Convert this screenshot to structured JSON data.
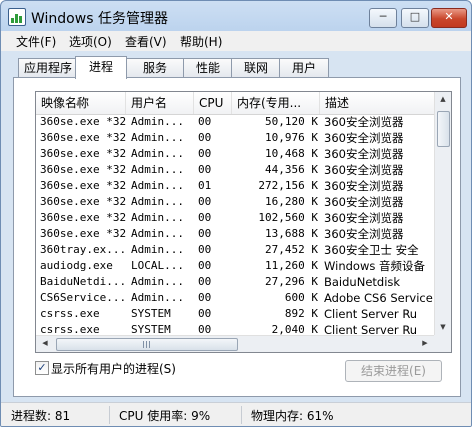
{
  "window": {
    "title": "Windows 任务管理器"
  },
  "menu": [
    "文件(F)",
    "选项(O)",
    "查看(V)",
    "帮助(H)"
  ],
  "tabs": [
    "应用程序",
    "进程",
    "服务",
    "性能",
    "联网",
    "用户"
  ],
  "active_tab": "进程",
  "columns": [
    "映像名称",
    "用户名",
    "CPU",
    "内存(专用...",
    "描述"
  ],
  "rows": [
    {
      "name": "360se.exe *32",
      "user": "Admin...",
      "cpu": "00",
      "mem": "50,120 K",
      "desc": "360安全浏览器"
    },
    {
      "name": "360se.exe *32",
      "user": "Admin...",
      "cpu": "00",
      "mem": "10,976 K",
      "desc": "360安全浏览器"
    },
    {
      "name": "360se.exe *32",
      "user": "Admin...",
      "cpu": "00",
      "mem": "10,468 K",
      "desc": "360安全浏览器"
    },
    {
      "name": "360se.exe *32",
      "user": "Admin...",
      "cpu": "00",
      "mem": "44,356 K",
      "desc": "360安全浏览器"
    },
    {
      "name": "360se.exe *32",
      "user": "Admin...",
      "cpu": "01",
      "mem": "272,156 K",
      "desc": "360安全浏览器"
    },
    {
      "name": "360se.exe *32",
      "user": "Admin...",
      "cpu": "00",
      "mem": "16,280 K",
      "desc": "360安全浏览器"
    },
    {
      "name": "360se.exe *32",
      "user": "Admin...",
      "cpu": "00",
      "mem": "102,560 K",
      "desc": "360安全浏览器"
    },
    {
      "name": "360se.exe *32",
      "user": "Admin...",
      "cpu": "00",
      "mem": "13,688 K",
      "desc": "360安全浏览器"
    },
    {
      "name": "360tray.ex...",
      "user": "Admin...",
      "cpu": "00",
      "mem": "27,452 K",
      "desc": "360安全卫士 安全"
    },
    {
      "name": "audiodg.exe",
      "user": "LOCAL...",
      "cpu": "00",
      "mem": "11,260 K",
      "desc": "Windows 音频设备"
    },
    {
      "name": "BaiduNetdi...",
      "user": "Admin...",
      "cpu": "00",
      "mem": "27,296 K",
      "desc": "BaiduNetdisk"
    },
    {
      "name": "CS6Service...",
      "user": "Admin...",
      "cpu": "00",
      "mem": "600 K",
      "desc": "Adobe CS6 Service"
    },
    {
      "name": "csrss.exe",
      "user": "SYSTEM",
      "cpu": "00",
      "mem": "892 K",
      "desc": "Client Server Ru"
    },
    {
      "name": "csrss.exe",
      "user": "SYSTEM",
      "cpu": "00",
      "mem": "2,040 K",
      "desc": "Client Server Ru"
    }
  ],
  "show_all_users": {
    "label": "显示所有用户的进程(S)",
    "checked": true
  },
  "end_process_label": "结束进程(E)",
  "status": {
    "processes": "进程数: 81",
    "cpu": "CPU 使用率: 9%",
    "memory": "物理内存: 61%"
  }
}
